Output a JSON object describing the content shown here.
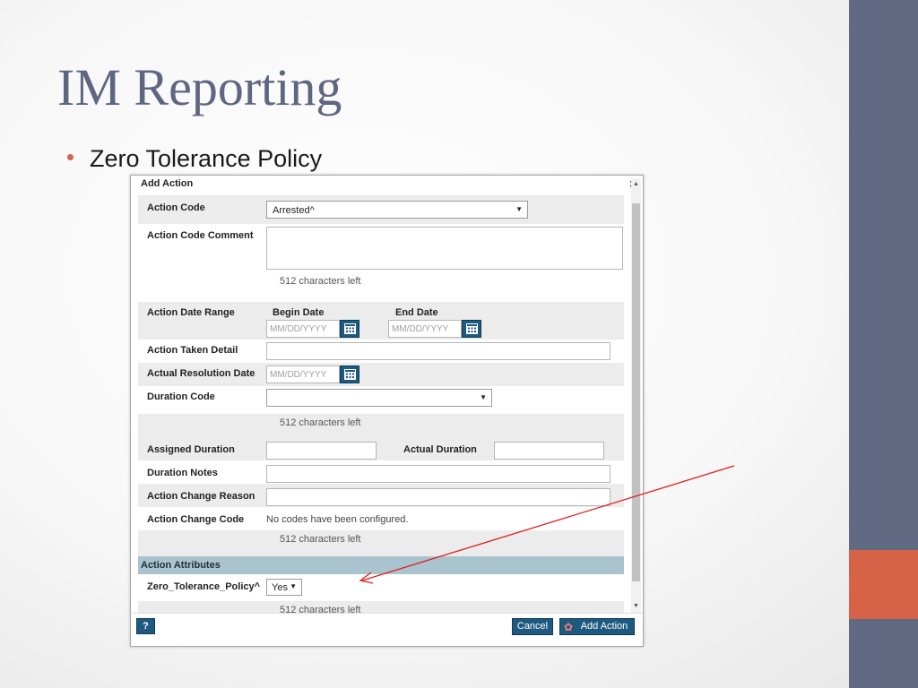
{
  "slide": {
    "title": "IM Reporting",
    "bullet": "Zero Tolerance Policy"
  },
  "dialog": {
    "title": "Add Action",
    "close_icon": "close-icon",
    "fields": {
      "action_code": {
        "label": "Action Code",
        "value": "Arrested^"
      },
      "action_code_comment": {
        "label": "Action Code Comment",
        "value": "",
        "hint": "512 characters left"
      },
      "action_date_range": {
        "label": "Action Date Range",
        "begin_label": "Begin Date",
        "end_label": "End Date",
        "begin_placeholder": "MM/DD/YYYY",
        "end_placeholder": "MM/DD/YYYY"
      },
      "action_taken_detail": {
        "label": "Action Taken Detail",
        "value": ""
      },
      "actual_resolution_date": {
        "label": "Actual Resolution Date",
        "placeholder": "MM/DD/YYYY"
      },
      "duration_code": {
        "label": "Duration Code",
        "value": "",
        "hint": "512 characters left"
      },
      "assigned_duration": {
        "label": "Assigned Duration",
        "value": ""
      },
      "actual_duration": {
        "label": "Actual Duration",
        "value": ""
      },
      "duration_notes": {
        "label": "Duration Notes",
        "value": ""
      },
      "action_change_reason": {
        "label": "Action Change Reason",
        "value": ""
      },
      "action_change_code": {
        "label": "Action Change Code",
        "value": "No codes have been configured.",
        "hint": "512 characters left"
      }
    },
    "section": {
      "title": "Action Attributes",
      "zero_tolerance": {
        "label": "Zero_Tolerance_Policy^",
        "value": "Yes"
      },
      "hint": "512 characters left"
    },
    "footer": {
      "help_label": "?",
      "cancel_label": "Cancel",
      "add_label": "Add Action"
    }
  },
  "colors": {
    "accent_blue": "#1e5a80",
    "section_bar": "#a9c4cf",
    "side_band": "#626983",
    "side_accent": "#d66247",
    "annotation_arrow": "#e0201a"
  }
}
